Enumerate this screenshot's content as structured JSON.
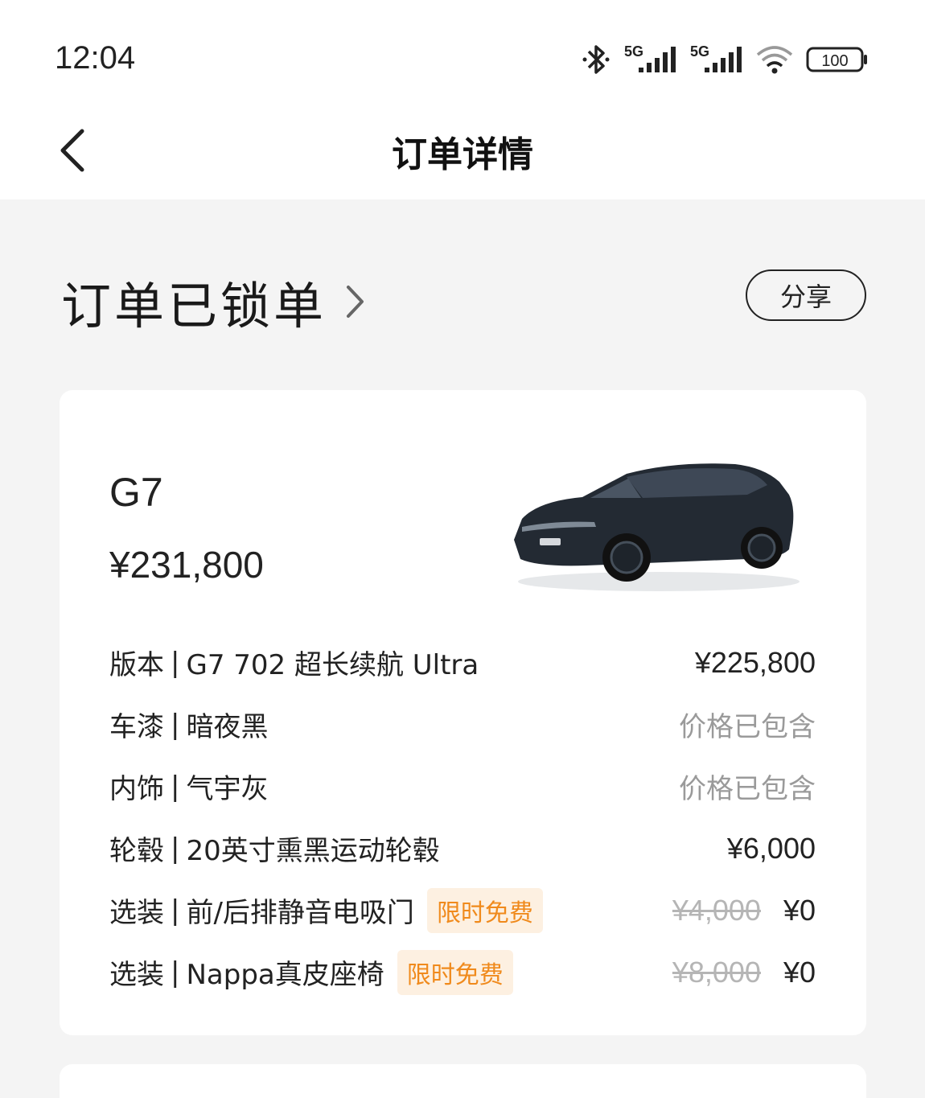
{
  "status_bar": {
    "time": "12:04",
    "net1": "5G",
    "net2": "5G",
    "battery": "100",
    "icons": [
      "bluetooth-icon",
      "signal-icon",
      "signal-icon",
      "wifi-icon",
      "battery-icon"
    ]
  },
  "nav": {
    "title": "订单详情",
    "back_icon": "chevron-left-icon"
  },
  "order": {
    "status": "订单已锁单",
    "share_label": "分享"
  },
  "card": {
    "model": "G7",
    "total_price": "¥231,800",
    "car_image": "car-image",
    "rows": [
      {
        "label": "版本",
        "sep": "|",
        "value": "G7 702 超长续航 Ultra",
        "price": "¥225,800"
      },
      {
        "label": "车漆",
        "sep": "|",
        "value": "暗夜黑",
        "price": "价格已包含"
      },
      {
        "label": "内饰",
        "sep": "|",
        "value": "气宇灰",
        "price": "价格已包含"
      },
      {
        "label": "轮毂",
        "sep": "|",
        "value": "20英寸熏黑运动轮毂",
        "price": "¥6,000"
      },
      {
        "label": "选装",
        "sep": "|",
        "value": "前/后排静音电吸门",
        "badge": "限时免费",
        "orig_price": "¥4,000",
        "price": "¥0"
      },
      {
        "label": "选装",
        "sep": "|",
        "value": "Nappa真皮座椅",
        "badge": "限时免费",
        "orig_price": "¥8,000",
        "price": "¥0"
      }
    ]
  },
  "colors": {
    "accent_orange": "#f08a1c",
    "badge_bg": "#fdf0e1",
    "page_bg": "#f4f4f4",
    "card_bg": "#ffffff",
    "muted_text": "#9a9a9a"
  }
}
